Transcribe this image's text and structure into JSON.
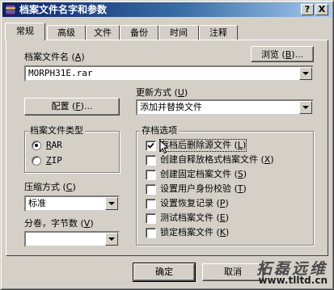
{
  "window": {
    "title": "档案文件名字和参数",
    "help_glyph": "?",
    "close_glyph": "X"
  },
  "tabs": [
    {
      "label": "常规",
      "active": true
    },
    {
      "label": "高级",
      "active": false
    },
    {
      "label": "文件",
      "active": false
    },
    {
      "label": "备份",
      "active": false
    },
    {
      "label": "时间",
      "active": false
    },
    {
      "label": "注释",
      "active": false
    }
  ],
  "archive_name": {
    "label": "档案文件名",
    "hotkey": "A",
    "value": "MORPH31E.rar",
    "browse_label": "浏览",
    "browse_hotkey": "B"
  },
  "update_mode": {
    "label": "更新方式",
    "hotkey": "U",
    "value": "添加并替换文件"
  },
  "profile_button": {
    "label": "配置",
    "hotkey": "F"
  },
  "archive_type": {
    "title": "档案文件类型",
    "options": [
      {
        "label": "RAR",
        "hotkey": "R",
        "selected": true
      },
      {
        "label": "ZIP",
        "hotkey": "Z",
        "selected": false
      }
    ]
  },
  "compression": {
    "label": "压缩方式",
    "hotkey": "C",
    "value": "标准"
  },
  "volumes": {
    "label": "分卷，字节数",
    "hotkey": "V",
    "value": ""
  },
  "archive_options": {
    "title": "存档选项",
    "items": [
      {
        "label": "存档后删除源文件",
        "hotkey": "L",
        "checked": true
      },
      {
        "label": "创建自释放格式档案文件",
        "hotkey": "X",
        "checked": false
      },
      {
        "label": "创建固定档案文件",
        "hotkey": "S",
        "checked": false
      },
      {
        "label": "设置用户身份校验",
        "hotkey": "T",
        "checked": false
      },
      {
        "label": "设置恢复记录",
        "hotkey": "P",
        "checked": false
      },
      {
        "label": "测试档案文件",
        "hotkey": "E",
        "checked": false
      },
      {
        "label": "锁定档案文件",
        "hotkey": "K",
        "checked": false
      }
    ]
  },
  "footer": {
    "ok_label": "确定",
    "cancel_label": "取消"
  },
  "watermark": {
    "line1": "拓磊远维",
    "line2": "www.tlltd.cn"
  }
}
